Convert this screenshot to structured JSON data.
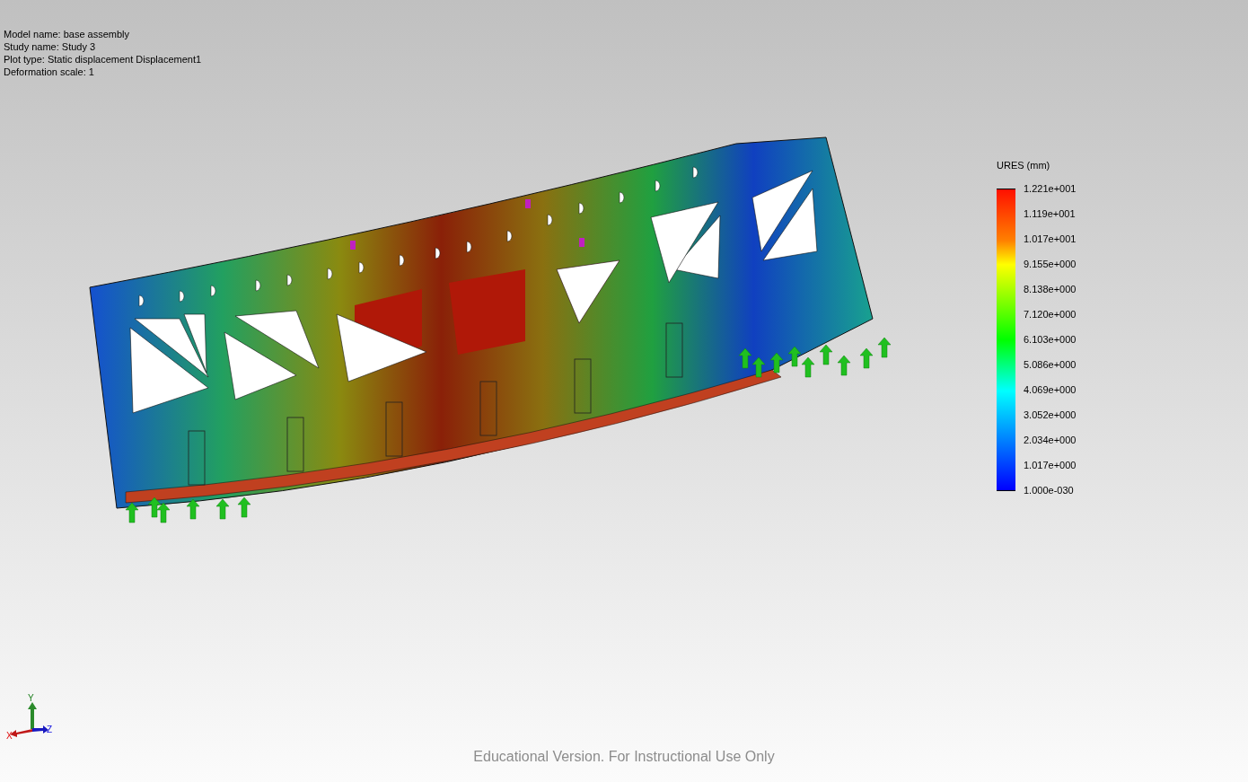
{
  "plot_info": [
    "Model name: base assembly",
    "Study name: Study 3",
    "Plot type: Static displacement Displacement1",
    "Deformation scale: 1"
  ],
  "legend": {
    "title": "URES (mm)",
    "labels": [
      "1.221e+001",
      "1.119e+001",
      "1.017e+001",
      "9.155e+000",
      "8.138e+000",
      "7.120e+000",
      "6.103e+000",
      "5.086e+000",
      "4.069e+000",
      "3.052e+000",
      "2.034e+000",
      "1.017e+000",
      "1.000e-030"
    ]
  },
  "triad": {
    "x": "X",
    "y": "Y",
    "z": "Z"
  },
  "watermark": "Educational Version. For Instructional Use Only"
}
